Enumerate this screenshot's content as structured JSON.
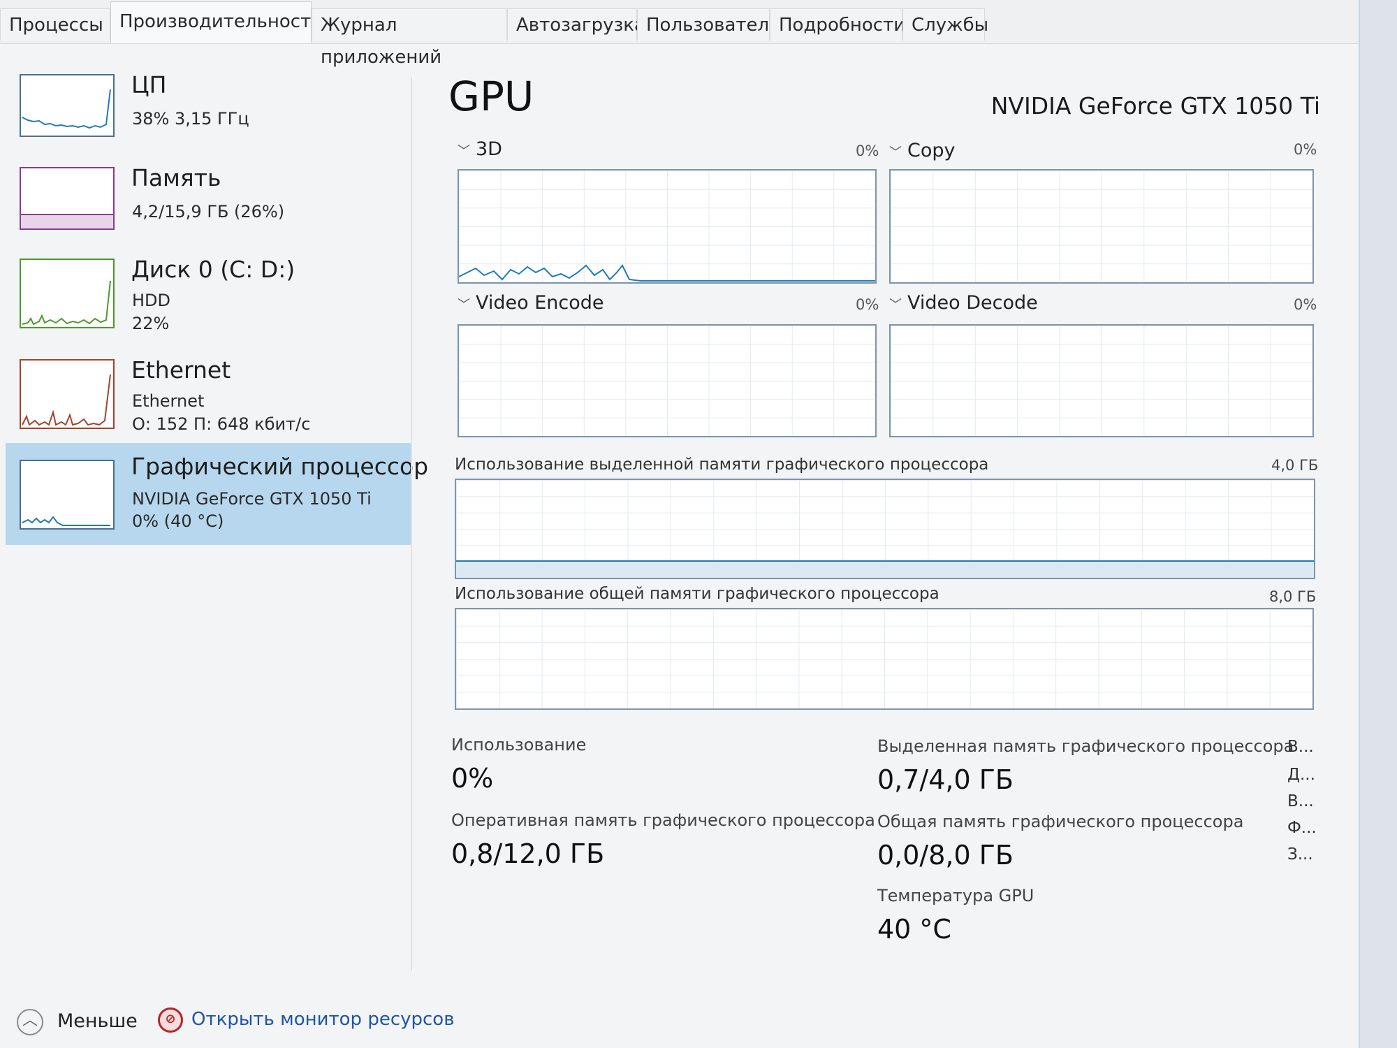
{
  "tabs": [
    "Процессы",
    "Производительность",
    "Журнал приложений",
    "Автозагрузка",
    "Пользователи",
    "Подробности",
    "Службы"
  ],
  "sidebar": {
    "items": [
      {
        "title": "ЦП",
        "sub1": "38% 3,15 ГГц",
        "sub2": "",
        "color": "#1f7bb6"
      },
      {
        "title": "Память",
        "sub1": "4,2/15,9 ГБ (26%)",
        "sub2": "",
        "color": "#8b3a8f"
      },
      {
        "title": "Диск 0 (C: D:)",
        "sub1": "HDD",
        "sub2": "22%",
        "color": "#4d9a2d"
      },
      {
        "title": "Ethernet",
        "sub1": "Ethernet",
        "sub2": "О: 152 П: 648 кбит/с",
        "color": "#a5422c"
      },
      {
        "title": "Графический процессор",
        "sub1": "NVIDIA GeForce GTX 1050 Ti",
        "sub2": "0% (40 °C)",
        "color": "#1f7bb6"
      }
    ]
  },
  "main": {
    "title": "GPU",
    "device": "NVIDIA GeForce GTX 1050 Ti",
    "engines": [
      {
        "name": "3D",
        "pct": "0%"
      },
      {
        "name": "Copy",
        "pct": "0%"
      },
      {
        "name": "Video Encode",
        "pct": "0%"
      },
      {
        "name": "Video Decode",
        "pct": "0%"
      }
    ],
    "dedicated_label": "Использование выделенной памяти графического процессора",
    "dedicated_max": "4,0 ГБ",
    "shared_label": "Использование общей памяти графического процессора",
    "shared_max": "8,0 ГБ",
    "stats": {
      "usage_label": "Использование",
      "usage_value": "0%",
      "ram_label": "Оперативная память графического процессора",
      "ram_value": "0,8/12,0 ГБ",
      "dedicated_label": "Выделенная память графического процессора",
      "dedicated_value": "0,7/4,0 ГБ",
      "shared_label": "Общая память графического процессора",
      "shared_value": "0,0/8,0 ГБ",
      "temp_label": "Температура GPU",
      "temp_value": "40 °C"
    },
    "truncated": [
      "В...",
      "Д...",
      "В...",
      "Ф...",
      "З..."
    ]
  },
  "footer": {
    "less_label": "Меньше",
    "resmon_label": "Открыть монитор ресурсов"
  },
  "colors": {
    "graph_border": "#7d96ac",
    "selected_bg": "#b6d7ee",
    "link": "#1f55a8"
  }
}
